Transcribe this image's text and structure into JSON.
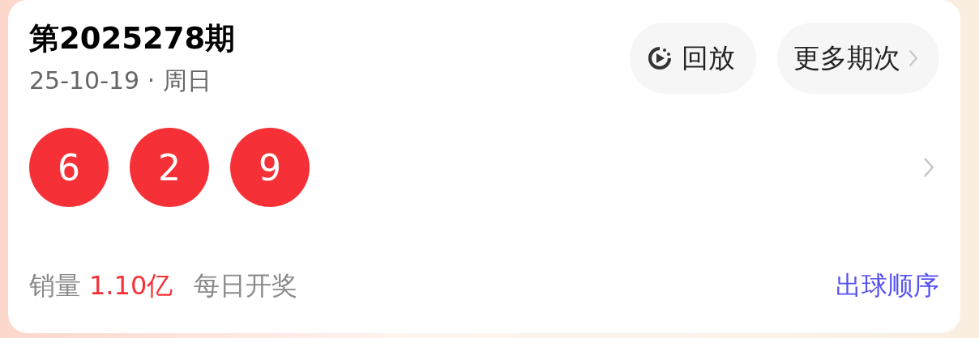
{
  "draw": {
    "title": "第2025278期",
    "date": "25-10-19 · 周日"
  },
  "buttons": [
    {
      "kind": "replay",
      "label": "回放"
    },
    {
      "kind": "more",
      "label": "更多期次"
    }
  ],
  "balls": [
    {
      "number": "6",
      "color": "#f53137"
    },
    {
      "number": "2",
      "color": "#f53137"
    },
    {
      "number": "9",
      "color": "#f53137"
    }
  ],
  "footer": {
    "sales_label": "销量",
    "sales_value": "1.10亿",
    "schedule": "每日开奖",
    "link": "出球顺序"
  }
}
